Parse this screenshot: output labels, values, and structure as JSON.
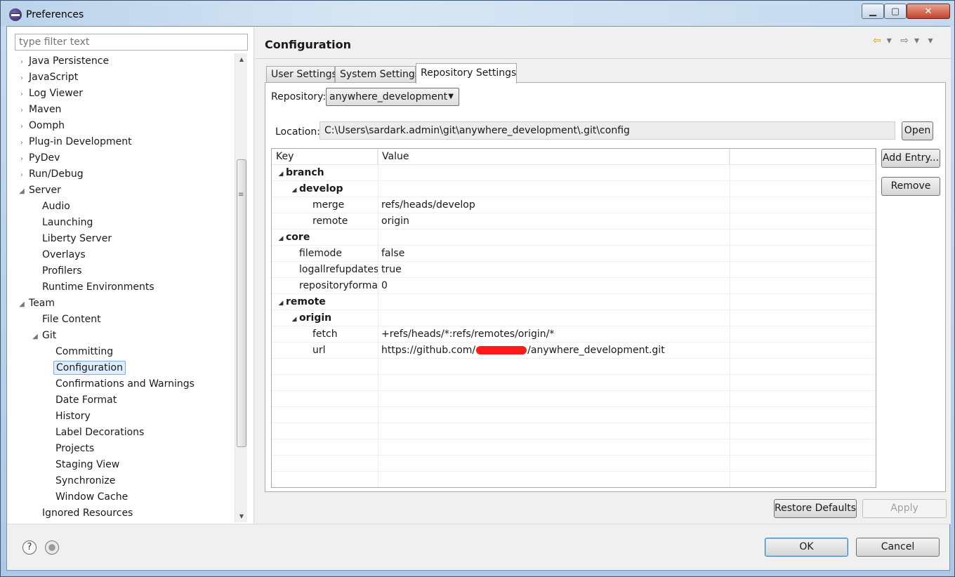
{
  "window": {
    "title": "Preferences"
  },
  "window_controls": {
    "minimize": "▁",
    "maximize": "▢",
    "close": "✕"
  },
  "filter": {
    "placeholder": "type filter text"
  },
  "tree": [
    {
      "label": "Java Persistence",
      "level": 0,
      "twisty": "›"
    },
    {
      "label": "JavaScript",
      "level": 0,
      "twisty": "›"
    },
    {
      "label": "Log Viewer",
      "level": 0,
      "twisty": "›"
    },
    {
      "label": "Maven",
      "level": 0,
      "twisty": "›"
    },
    {
      "label": "Oomph",
      "level": 0,
      "twisty": "›"
    },
    {
      "label": "Plug-in Development",
      "level": 0,
      "twisty": "›"
    },
    {
      "label": "PyDev",
      "level": 0,
      "twisty": "›"
    },
    {
      "label": "Run/Debug",
      "level": 0,
      "twisty": "›"
    },
    {
      "label": "Server",
      "level": 0,
      "twisty": "◢"
    },
    {
      "label": "Audio",
      "level": 1,
      "twisty": ""
    },
    {
      "label": "Launching",
      "level": 1,
      "twisty": ""
    },
    {
      "label": "Liberty Server",
      "level": 1,
      "twisty": ""
    },
    {
      "label": "Overlays",
      "level": 1,
      "twisty": ""
    },
    {
      "label": "Profilers",
      "level": 1,
      "twisty": ""
    },
    {
      "label": "Runtime Environments",
      "level": 1,
      "twisty": ""
    },
    {
      "label": "Team",
      "level": 0,
      "twisty": "◢"
    },
    {
      "label": "File Content",
      "level": 1,
      "twisty": ""
    },
    {
      "label": "Git",
      "level": 1,
      "twisty": "◢"
    },
    {
      "label": "Committing",
      "level": 2,
      "twisty": ""
    },
    {
      "label": "Configuration",
      "level": 2,
      "twisty": "",
      "selected": true
    },
    {
      "label": "Confirmations and Warnings",
      "level": 2,
      "twisty": ""
    },
    {
      "label": "Date Format",
      "level": 2,
      "twisty": ""
    },
    {
      "label": "History",
      "level": 2,
      "twisty": ""
    },
    {
      "label": "Label Decorations",
      "level": 2,
      "twisty": ""
    },
    {
      "label": "Projects",
      "level": 2,
      "twisty": ""
    },
    {
      "label": "Staging View",
      "level": 2,
      "twisty": ""
    },
    {
      "label": "Synchronize",
      "level": 2,
      "twisty": ""
    },
    {
      "label": "Window Cache",
      "level": 2,
      "twisty": ""
    },
    {
      "label": "Ignored Resources",
      "level": 1,
      "twisty": ""
    }
  ],
  "page": {
    "title": "Configuration"
  },
  "nav": {
    "back": "⇦",
    "forward": "⇨",
    "menu": "▾"
  },
  "tabs": [
    {
      "label": "User Settings",
      "active": false
    },
    {
      "label": "System Settings",
      "active": false
    },
    {
      "label": "Repository Settings",
      "active": true
    }
  ],
  "repository": {
    "label": "Repository:",
    "value": "anywhere_development",
    "caret": "▼"
  },
  "location": {
    "label": "Location:",
    "value": "C:\\Users\\sardark.admin\\git\\anywhere_development\\.git\\config",
    "open_label": "Open"
  },
  "table": {
    "columns": [
      "Key",
      "Value"
    ],
    "rows": [
      {
        "key": "branch",
        "value": "",
        "level": 0,
        "twisty": "◢",
        "bold": true
      },
      {
        "key": "develop",
        "value": "",
        "level": 1,
        "twisty": "◢",
        "bold": true
      },
      {
        "key": "merge",
        "value": "refs/heads/develop",
        "level": 2,
        "twisty": "",
        "bold": false
      },
      {
        "key": "remote",
        "value": "origin",
        "level": 2,
        "twisty": "",
        "bold": false
      },
      {
        "key": "core",
        "value": "",
        "level": 0,
        "twisty": "◢",
        "bold": true
      },
      {
        "key": "filemode",
        "value": "false",
        "level": 1,
        "twisty": "",
        "bold": false
      },
      {
        "key": "logallrefupdates",
        "value": "true",
        "level": 1,
        "twisty": "",
        "bold": false
      },
      {
        "key": "repositoryformatversion",
        "value": "0",
        "level": 1,
        "twisty": "",
        "bold": false
      },
      {
        "key": "remote",
        "value": "",
        "level": 0,
        "twisty": "◢",
        "bold": true
      },
      {
        "key": "origin",
        "value": "",
        "level": 1,
        "twisty": "◢",
        "bold": true
      },
      {
        "key": "fetch",
        "value": "+refs/heads/*:refs/remotes/origin/*",
        "level": 2,
        "twisty": "",
        "bold": false
      },
      {
        "key": "url",
        "value": "",
        "value_prefix": "https://github.com/",
        "value_suffix": "/anywhere_development.git",
        "redacted": true,
        "level": 2,
        "twisty": "",
        "bold": false
      }
    ]
  },
  "buttons": {
    "add_entry": "Add Entry...",
    "remove": "Remove",
    "restore_defaults": "Restore Defaults",
    "apply": "Apply",
    "ok": "OK",
    "cancel": "Cancel"
  },
  "footer": {
    "help_icon": "?"
  },
  "colors": {
    "selection": "#dfeeff",
    "redaction": "#ff1a1a",
    "nav_back": "#d89a1d"
  }
}
